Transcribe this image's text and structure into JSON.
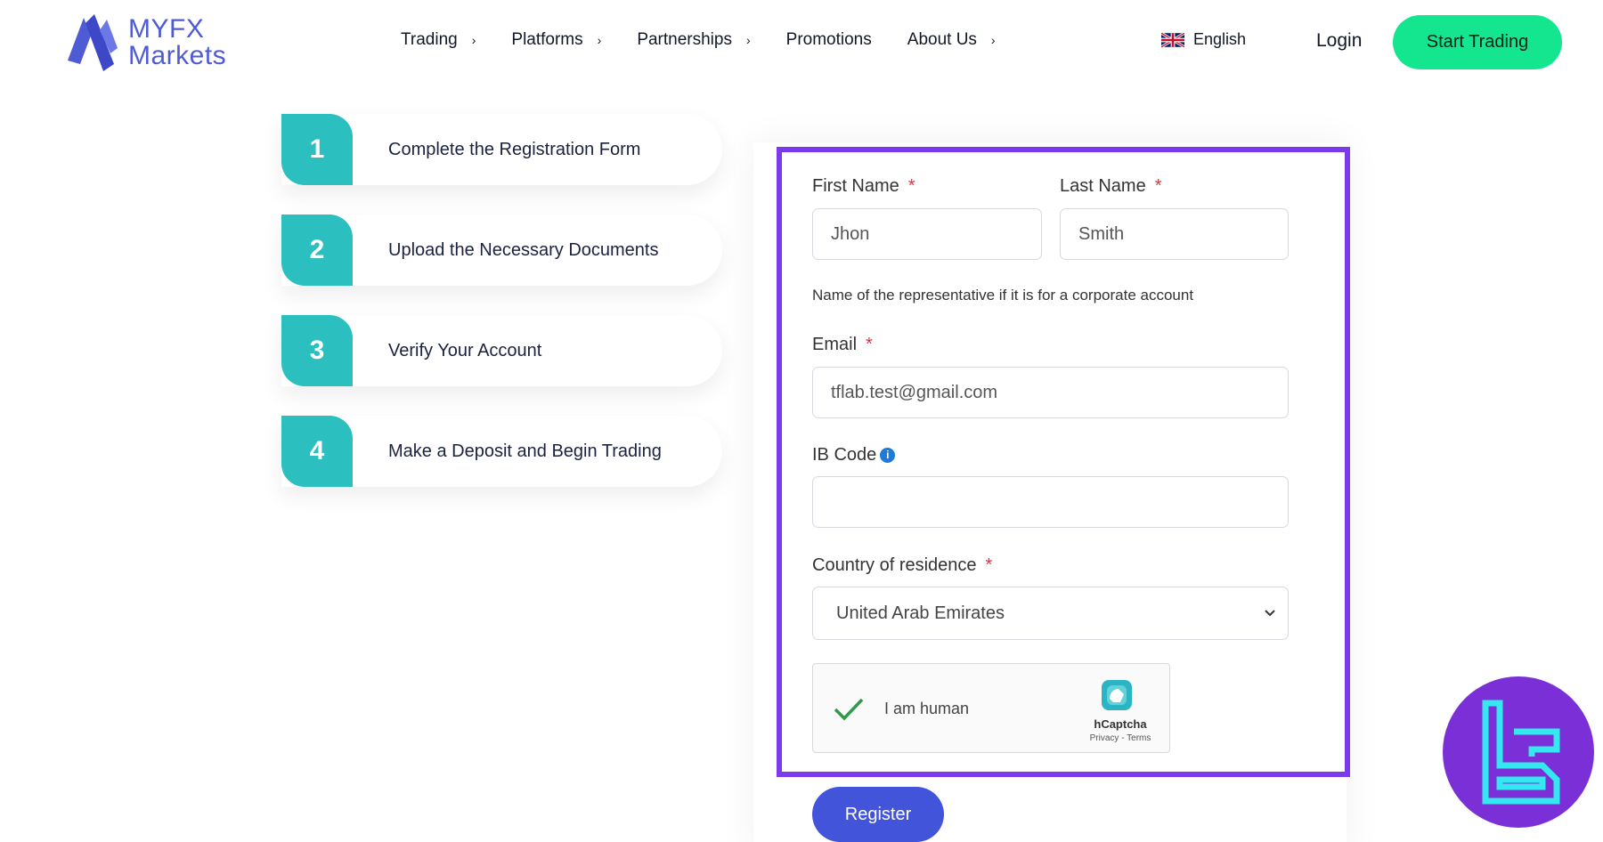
{
  "brand": {
    "line1": "MYFX",
    "line2": "Markets",
    "color": "#4f5bd5"
  },
  "nav": {
    "items": [
      {
        "label": "Trading",
        "has_chevron": true
      },
      {
        "label": "Platforms",
        "has_chevron": true
      },
      {
        "label": "Partnerships",
        "has_chevron": true
      },
      {
        "label": "Promotions",
        "has_chevron": false
      },
      {
        "label": "About Us",
        "has_chevron": true
      }
    ],
    "language": "English",
    "language_icon": "uk-flag-icon",
    "login": "Login",
    "start_trading": "Start Trading",
    "cta_color": "#14e68f"
  },
  "steps": [
    {
      "num": "1",
      "label": "Complete the Registration Form"
    },
    {
      "num": "2",
      "label": "Upload the Necessary Documents"
    },
    {
      "num": "3",
      "label": "Verify Your Account"
    },
    {
      "num": "4",
      "label": "Make a Deposit and Begin Trading"
    }
  ],
  "form": {
    "first_name": {
      "label": "First Name",
      "value": "Jhon"
    },
    "last_name": {
      "label": "Last Name",
      "value": "Smith"
    },
    "name_hint": "Name of the representative if it is for a corporate account",
    "email": {
      "label": "Email",
      "value": "tflab.test@gmail.com"
    },
    "ib_code": {
      "label": "IB Code",
      "value": ""
    },
    "country": {
      "label": "Country of residence",
      "value": "United Arab Emirates"
    },
    "required_mark": "*",
    "captcha": {
      "label": "I am human",
      "brand": "hCaptcha",
      "links": "Privacy - Terms"
    },
    "register": "Register",
    "highlight_color": "#7c3aed",
    "register_color": "#4254d9"
  }
}
